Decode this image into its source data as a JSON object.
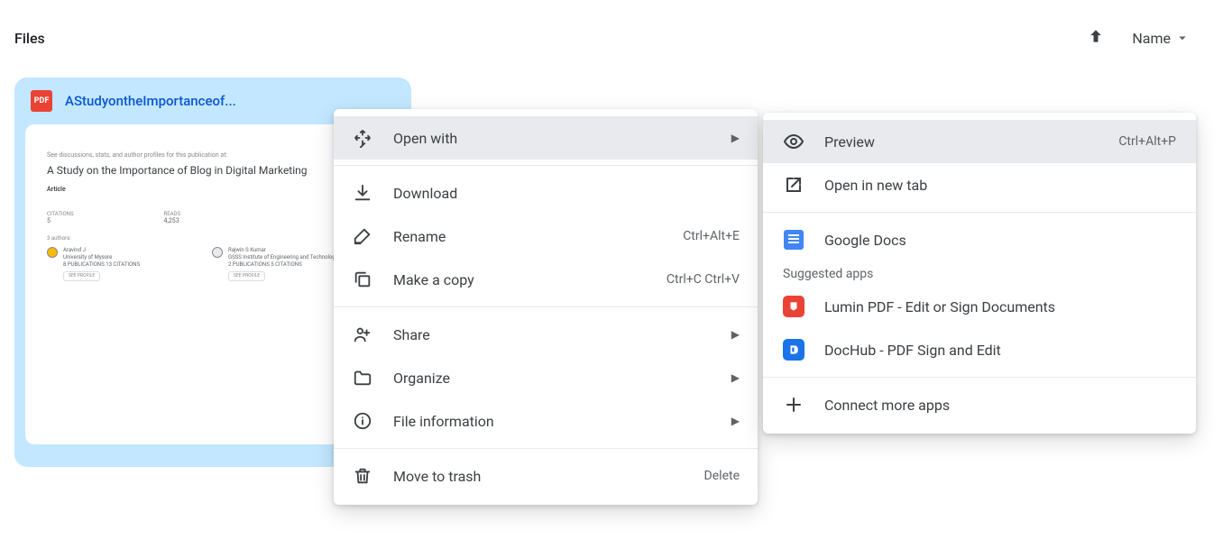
{
  "header": {
    "title": "Files",
    "sort_label": "Name"
  },
  "file": {
    "badge": "PDF",
    "name": "AStudyontheImportanceof...",
    "preview": {
      "subline": "See discussions, stats, and author profiles for this publication at:",
      "title": "A Study on the Importance of Blog in Digital Marketing",
      "meta": "Article",
      "col1_label": "CITATIONS",
      "col1_value": "5",
      "col2_label": "READS",
      "col2_value": "4,253",
      "authors_label": "3 authors:",
      "author1_name": "Aravind J",
      "author1_affil": "University of Mysore",
      "author1_stats": "8 PUBLICATIONS   13 CITATIONS",
      "author1_btn": "SEE PROFILE",
      "author2_name": "Rajwin S Kumar",
      "author2_affil": "GSSS Institute of Engineering and Technology for Women",
      "author2_stats": "2 PUBLICATIONS   5 CITATIONS",
      "author2_btn": "SEE PROFILE"
    }
  },
  "menu": {
    "open_with": "Open with",
    "download": "Download",
    "rename": "Rename",
    "rename_shortcut": "Ctrl+Alt+E",
    "make_copy": "Make a copy",
    "make_copy_shortcut": "Ctrl+C Ctrl+V",
    "share": "Share",
    "organize": "Organize",
    "file_info": "File information",
    "move_trash": "Move to trash",
    "move_trash_shortcut": "Delete"
  },
  "submenu": {
    "preview": "Preview",
    "preview_shortcut": "Ctrl+Alt+P",
    "open_new_tab": "Open in new tab",
    "google_docs": "Google Docs",
    "suggested_label": "Suggested apps",
    "lumin": "Lumin PDF - Edit or Sign Documents",
    "dochub": "DocHub - PDF Sign and Edit",
    "connect_more": "Connect more apps"
  }
}
